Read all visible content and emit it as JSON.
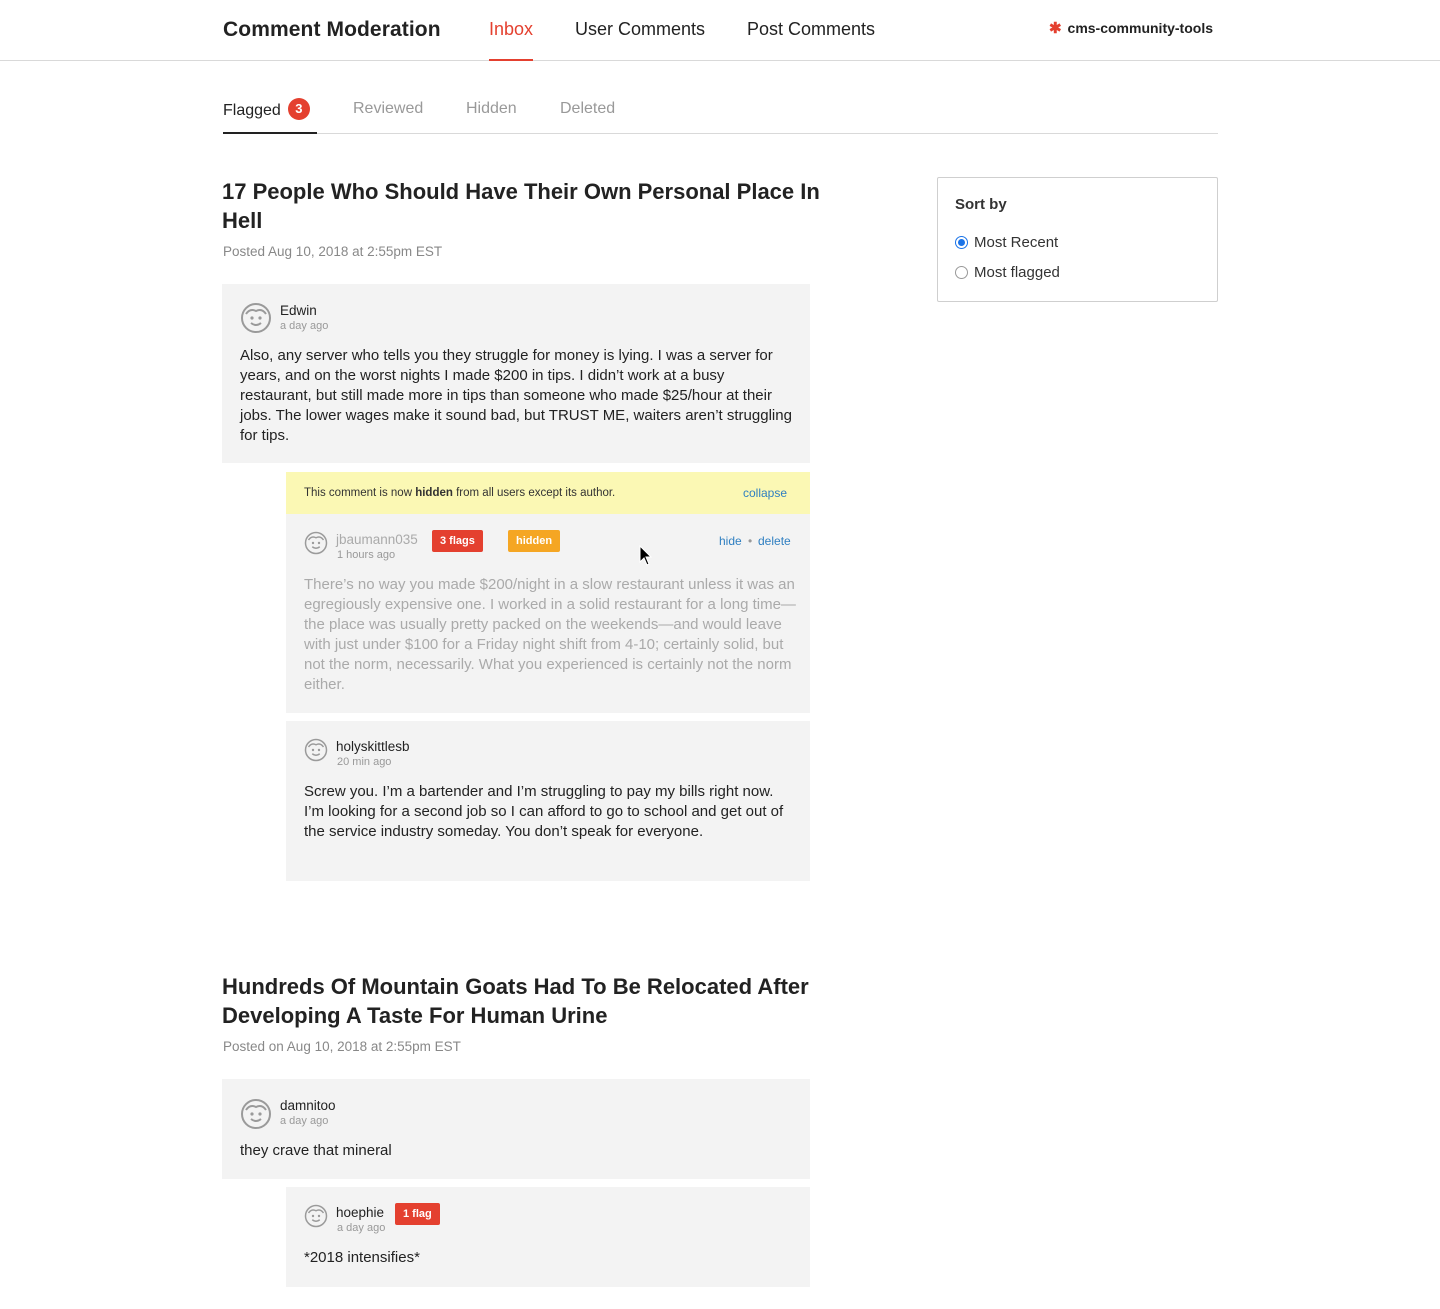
{
  "header": {
    "title": "Comment Moderation",
    "tabs": [
      "Inbox",
      "User Comments",
      "Post Comments"
    ],
    "active_tab": "Inbox",
    "brand": "cms-community-tools"
  },
  "subtabs": {
    "items": [
      "Flagged",
      "Reviewed",
      "Hidden",
      "Deleted"
    ],
    "flagged_count": "3",
    "active": "Flagged"
  },
  "sort": {
    "title": "Sort by",
    "options": [
      "Most Recent",
      "Most flagged"
    ],
    "selected": "Most Recent"
  },
  "posts": [
    {
      "title": "17 People Who Should Have Their Own Personal Place In Hell",
      "date": "Posted Aug 10, 2018 at 2:55pm EST",
      "comment": {
        "user": "Edwin",
        "time": "a day ago",
        "text": "Also, any server who tells you they struggle for money is lying. I was a server for years, and on the worst nights I made $200 in tips. I didn’t work at a busy restaurant, but still made more in tips than someone who made $25/hour at their jobs. The lower wages make it sound bad, but TRUST ME, waiters aren’t struggling for tips."
      },
      "notice": {
        "prefix": "This comment is now ",
        "bold": "hidden",
        "suffix": " from all users except its author.",
        "collapse": "collapse"
      },
      "replies": [
        {
          "user": "jbaumann035",
          "time": "1 hours ago",
          "flags": "3 flags",
          "status": "hidden",
          "actions": [
            "hide",
            "delete"
          ],
          "text": "There’s no way you made $200/night in a slow restaurant unless it was an egregiously expensive one. I worked in a solid restaurant for a long time—the place was usually pretty packed on the weekends—and would leave with just under $100 for a Friday night shift from 4-10; certainly solid, but not the norm, necessarily. What you experienced is certainly not the norm either."
        },
        {
          "user": "holyskittlesb",
          "time": "20 min ago",
          "text": "Screw you. I’m a bartender and I’m struggling to pay my bills right now. I’m looking for a second job so I can afford to go to school and get out of the service industry someday. You don’t speak for everyone."
        }
      ]
    },
    {
      "title": "Hundreds Of Mountain Goats Had To Be Relocated After Developing A Taste For Human Urine",
      "date": "Posted on Aug 10, 2018 at 2:55pm EST",
      "comment": {
        "user": "damnitoo",
        "time": "a day ago",
        "text": "they crave that mineral"
      },
      "replies": [
        {
          "user": "hoephie",
          "time": "a day ago",
          "flags": "1 flag",
          "text": "*2018 intensifies*"
        }
      ]
    }
  ],
  "colors": {
    "accent": "#e4402f",
    "link": "#2f7fc1",
    "hidden_badge": "#f5a623",
    "notice_bg": "#fbf8b4",
    "comment_bg": "#f3f3f3"
  }
}
